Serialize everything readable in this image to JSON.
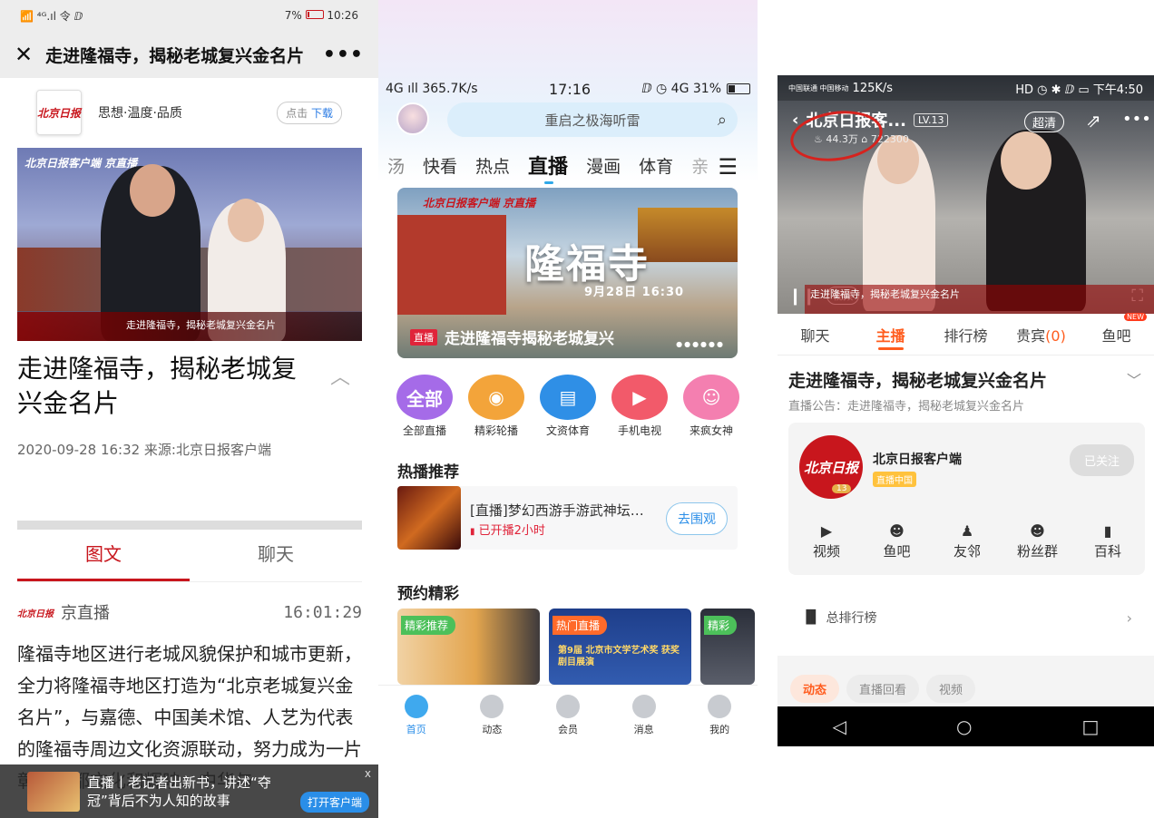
{
  "phone1": {
    "status": {
      "left": "📶 ⁴ᴳ.ıl 令 ⅅ",
      "battery": "7%",
      "time": "10:26"
    },
    "nav": {
      "close": "✕",
      "title": "走进隆福寺，揭秘老城复兴金名片",
      "more": "•••"
    },
    "brand": {
      "logo": "北京日报",
      "logo_sub": "BEIJING DAILY",
      "tagline": "思想·温度·品质",
      "download_a": "点击",
      "download_b": "下载"
    },
    "video": {
      "tag": "北京日报客户端  京直播",
      "caption": "走进隆福寺，揭秘老城复兴金名片"
    },
    "article": {
      "title": "走进隆福寺，揭秘老城复兴金名片",
      "meta": "2020-09-28 16:32  来源:北京日报客户端"
    },
    "tabs": [
      "图文",
      "聊天"
    ],
    "post": {
      "author": "京直播",
      "time": "16:01:29",
      "body": "隆福寺地区进行老城风貌保护和城市更新，全力将隆福寺地区打造为“北京老城复兴金名片”，与嘉德、中国美术馆、人艺为代表的隆福寺周边文化资源联动，努力成为一片彰显古都文化和辉映、中华与"
    },
    "banner": {
      "text": "直播丨老记者出新书，讲述“夺冠”背后不为人知的故事",
      "button": "打开客户端",
      "close": "x"
    }
  },
  "phone2": {
    "status": {
      "signal": "4G ıll 365.7K/s",
      "time": "17:16",
      "right": "ⅅ ◷ 4G 31%"
    },
    "search_placeholder": "重启之极海听雷",
    "tabs": [
      "汤",
      "快看",
      "热点",
      "直播",
      "漫画",
      "体育",
      "亲"
    ],
    "hero": {
      "logo": "北京日报客户端 京直播",
      "big": "隆福寺",
      "date": "9月28日 16:30",
      "badge": "直播",
      "title": "走进隆福寺揭秘老城复兴",
      "dots": "●●●●●●"
    },
    "categories": [
      {
        "label": "全部直播",
        "icon": "全部",
        "color": "#a56be8"
      },
      {
        "label": "精彩轮播",
        "icon": "◉",
        "color": "#f3a43a"
      },
      {
        "label": "文资体育",
        "icon": "▤",
        "color": "#2f8fe6"
      },
      {
        "label": "手机电视",
        "icon": "▶",
        "color": "#f25a6a"
      },
      {
        "label": "来疯女神",
        "icon": "☺",
        "color": "#f47fb0"
      }
    ],
    "hot_title": "热播推荐",
    "hot": {
      "title": "[直播]梦幻西游手游武神坛…",
      "status": "已开播2小时",
      "button": "去围观"
    },
    "book_title": "预约精彩",
    "cards": [
      {
        "tag": "精彩推荐",
        "bg": "#e3a54e",
        "tagbg": "#4cc05a"
      },
      {
        "tag": "热门直播",
        "bg": "#264a9a",
        "tagbg": "#ff6a2a",
        "sub": "第9届 北京市文学艺术奖 获奖剧目展演"
      },
      {
        "tag": "精彩",
        "bg": "#2b2f3a",
        "tagbg": "#4cc05a"
      }
    ],
    "bottom": [
      "首页",
      "动态",
      "会员",
      "消息",
      "我的"
    ]
  },
  "phone3": {
    "status": {
      "carrier": "中国联通 中国移动",
      "speed": "125K/s",
      "right": "HD ◷ ✱ ⅅ ▭ 下午4:50"
    },
    "video": {
      "title": "北京日报客...",
      "level": "LV.13",
      "hd": "超清",
      "stats": "♨ 44.3万  ⌂ 722300",
      "vbutton": "视频",
      "caption": "走进隆福寺，揭秘老城复兴金名片"
    },
    "tabs": [
      "聊天",
      "主播",
      "排行榜",
      "贵宾",
      "鱼吧"
    ],
    "vip_count": "(0)",
    "new_badge": "NEW",
    "title": "走进隆福寺，揭秘老城复兴金名片",
    "notice": "直播公告：走进隆福寺，揭秘老城复兴金名片",
    "anchor": {
      "logo": "北京日报",
      "level": "13",
      "name": "北京日报客户端",
      "badge": "直播中国",
      "follow": "已关注"
    },
    "links": [
      {
        "icon": "▶",
        "label": "视频"
      },
      {
        "icon": "☻",
        "label": "鱼吧"
      },
      {
        "icon": "♟",
        "label": "友邻"
      },
      {
        "icon": "☻",
        "label": "粉丝群"
      },
      {
        "icon": "▮",
        "label": "百科"
      }
    ],
    "rank": "总排行榜",
    "pills": [
      "动态",
      "直播回看",
      "视频"
    ]
  }
}
